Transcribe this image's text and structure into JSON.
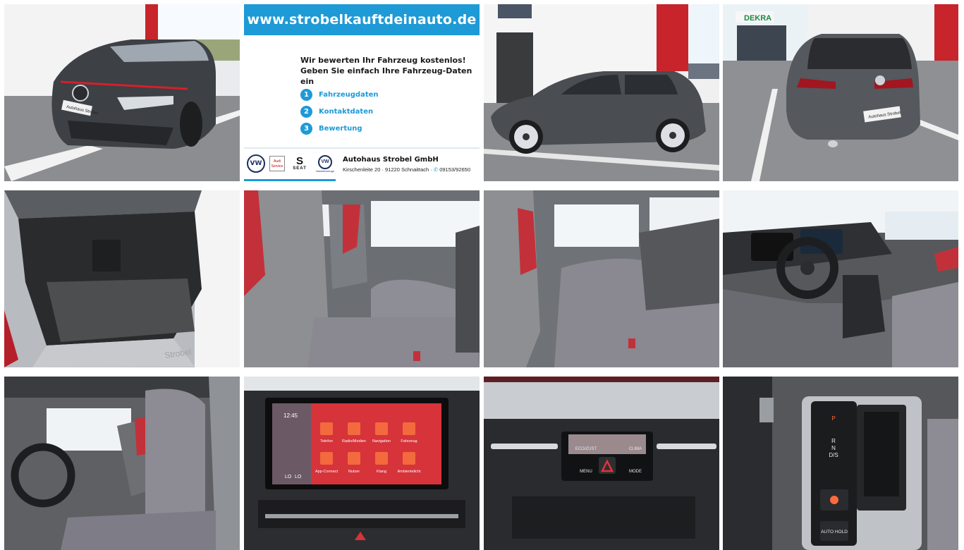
{
  "gallery": {
    "promo": {
      "url": "www.strobelkauftdeinauto.de",
      "headline_line1": "Wir bewerten Ihr Fahrzeug kostenlos!",
      "headline_line2": "Geben Sie einfach Ihre Fahrzeug-Daten ein",
      "steps": [
        {
          "num": "1",
          "label": "Fahrzeugdaten"
        },
        {
          "num": "2",
          "label": "Kontaktdaten"
        },
        {
          "num": "3",
          "label": "Bewertung"
        }
      ],
      "logo_vw": "VW",
      "logo_audi": "Audi Service",
      "logo_seat_mark": "S",
      "logo_seat": "SEAT",
      "logo_vw_nutz": "Nutzfahrzeuge",
      "dealer_name": "Autohaus Strobel GmbH",
      "dealer_address": "Kirschenleite 20 · 91220 Schnaittach · ",
      "dealer_phone": "09153/92650"
    },
    "photo_text": {
      "plate_front": "Autohaus Strobel",
      "sign_dekra": "DEKRA",
      "plate_rear": "Autohaus Strobel",
      "trunk_plate": "Strobel",
      "climate_left": "ECO/ZUST",
      "climate_right": "CLIMA",
      "climate_menu": "MENU",
      "climate_mode": "MODE",
      "infotainment_time": "12:45",
      "apps": [
        "Telefon",
        "Radio/Medien",
        "Navigation",
        "Fahrzeug",
        "App-Connect",
        "Nutzer",
        "Klang",
        "Ambientelicht"
      ],
      "temp_left": "LO",
      "temp_right": "LO",
      "gear_p": "P",
      "gear_r": "R",
      "gear_n": "N",
      "gear_ds": "D/S",
      "auto_hold": "AUTO HOLD"
    }
  }
}
